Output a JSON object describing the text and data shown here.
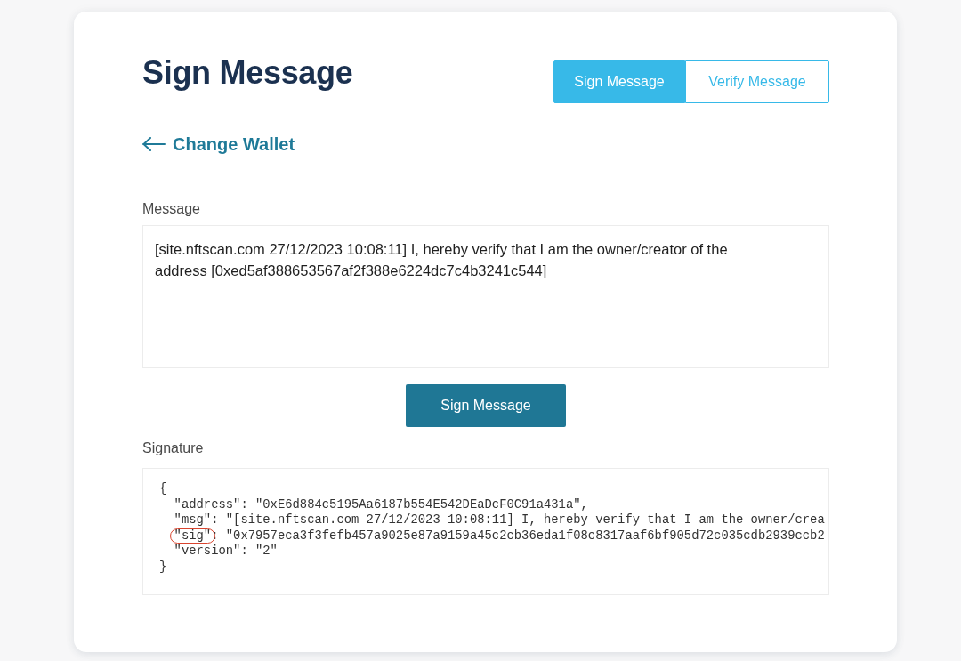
{
  "page": {
    "title": "Sign Message"
  },
  "tabs": [
    {
      "label": "Sign Message",
      "selected": true
    },
    {
      "label": "Verify Message",
      "selected": false
    }
  ],
  "back_link": {
    "label": "Change Wallet"
  },
  "message": {
    "label": "Message",
    "value": "[site.nftscan.com 27/12/2023 10:08:11] I, hereby verify that I am the owner/creator of the address [0xed5af388653567af2f388e6224dc7c4b3241c544]"
  },
  "sign_button": {
    "label": "Sign Message"
  },
  "signature": {
    "label": "Signature",
    "open": "{",
    "fields": [
      {
        "key": "\"address\"",
        "rest": ": \"0xE6d884c5195Aa6187b554E542DEaDcF0C91a431a\",",
        "circled": false
      },
      {
        "key": "\"msg\"",
        "rest": ": \"[site.nftscan.com 27/12/2023 10:08:11] I, hereby verify that I am the owner/crea",
        "circled": false
      },
      {
        "key": "\"sig\"",
        "rest": ": \"0x7957eca3f3fefb457a9025e87a9159a45c2cb36eda1f08c8317aaf6bf905d72c035cdb2939ccb2",
        "circled": true
      },
      {
        "key": "\"version\"",
        "rest": ": \"2\"",
        "circled": false
      }
    ],
    "close": "}"
  }
}
